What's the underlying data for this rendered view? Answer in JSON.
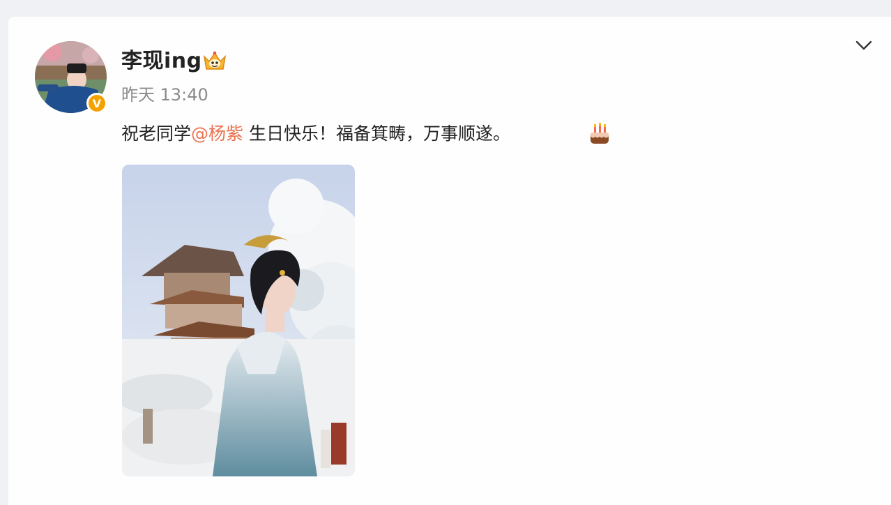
{
  "post": {
    "author": "李现ing",
    "timestamp": "昨天 13:40",
    "text_before": "祝老同学",
    "mention": "@杨紫",
    "text_after": " 生日快乐！福备箕畴，万事顺遂。",
    "emoji": "cake-emoji",
    "verified_badge": "V"
  },
  "colors": {
    "mention": "#eb7350",
    "badge": "#f5a200",
    "text": "#222222",
    "time": "#8a8a8a"
  },
  "icons": [
    "crown-icon",
    "chevron-down-icon",
    "cake-icon",
    "verified-badge-icon"
  ]
}
